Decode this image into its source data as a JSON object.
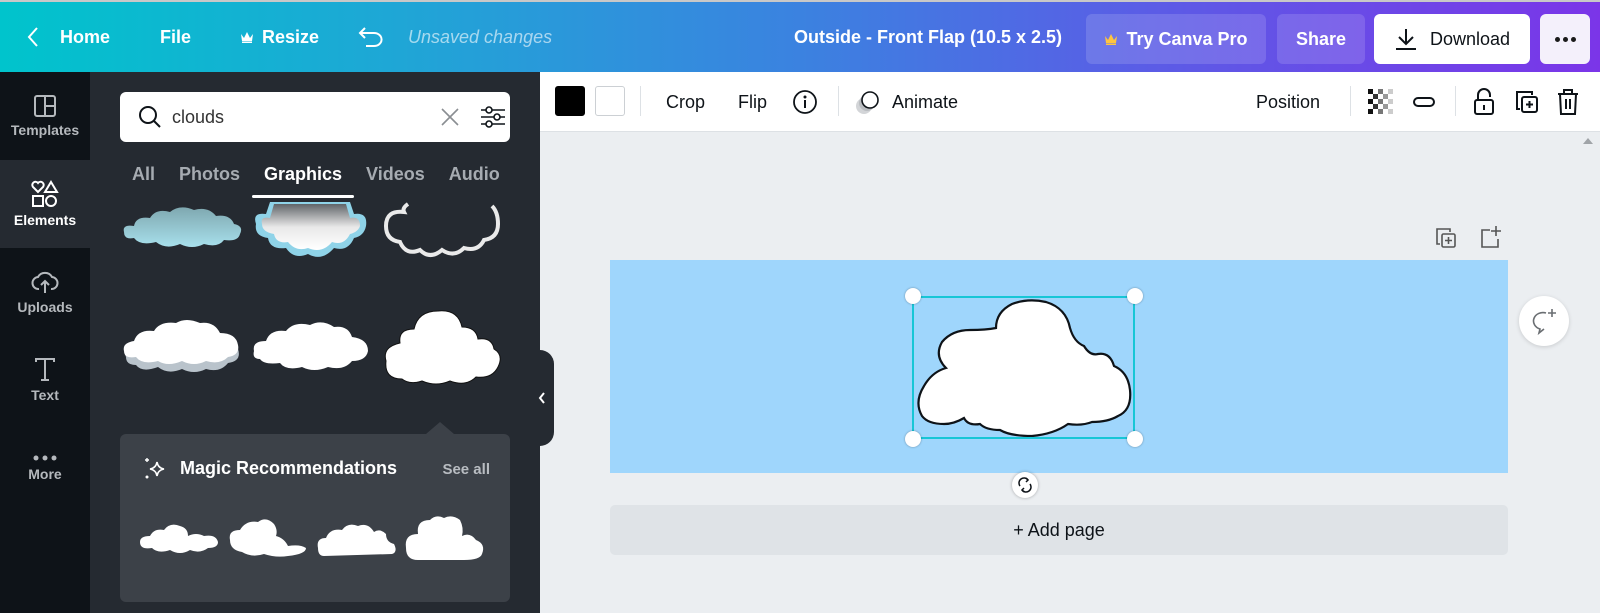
{
  "topbar": {
    "home_label": "Home",
    "file_label": "File",
    "resize_label": "Resize",
    "status_text": "Unsaved changes",
    "document_title": "Outside - Front Flap (10.5 x 2.5)",
    "try_pro_label": "Try Canva Pro",
    "share_label": "Share",
    "download_label": "Download"
  },
  "rail": {
    "items": [
      {
        "label": "Templates",
        "icon": "templates-icon"
      },
      {
        "label": "Elements",
        "icon": "elements-icon",
        "active": true
      },
      {
        "label": "Uploads",
        "icon": "upload-cloud-icon"
      },
      {
        "label": "Text",
        "icon": "text-icon"
      },
      {
        "label": "More",
        "icon": "more-dots-icon"
      }
    ]
  },
  "panel": {
    "search": {
      "value": "clouds",
      "placeholder": "Search elements"
    },
    "tabs": [
      {
        "label": "All"
      },
      {
        "label": "Photos"
      },
      {
        "label": "Graphics",
        "active": true
      },
      {
        "label": "Videos"
      },
      {
        "label": "Audio"
      }
    ],
    "magic": {
      "title": "Magic Recommendations",
      "see_all_label": "See all"
    }
  },
  "toolbar": {
    "stroke_color": "#000000",
    "fill_color": "#ffffff",
    "crop_label": "Crop",
    "flip_label": "Flip",
    "animate_label": "Animate",
    "position_label": "Position"
  },
  "canvas": {
    "background_color": "#9fd6fc",
    "selection_color": "#17c6d6",
    "add_page_label": "+ Add page"
  },
  "colors": {
    "gradient_start": "#00c4cc",
    "gradient_end": "#7b35e8",
    "crown": "#ffc53d",
    "rail_bg": "#0e1318",
    "panel_bg": "#252a31"
  }
}
